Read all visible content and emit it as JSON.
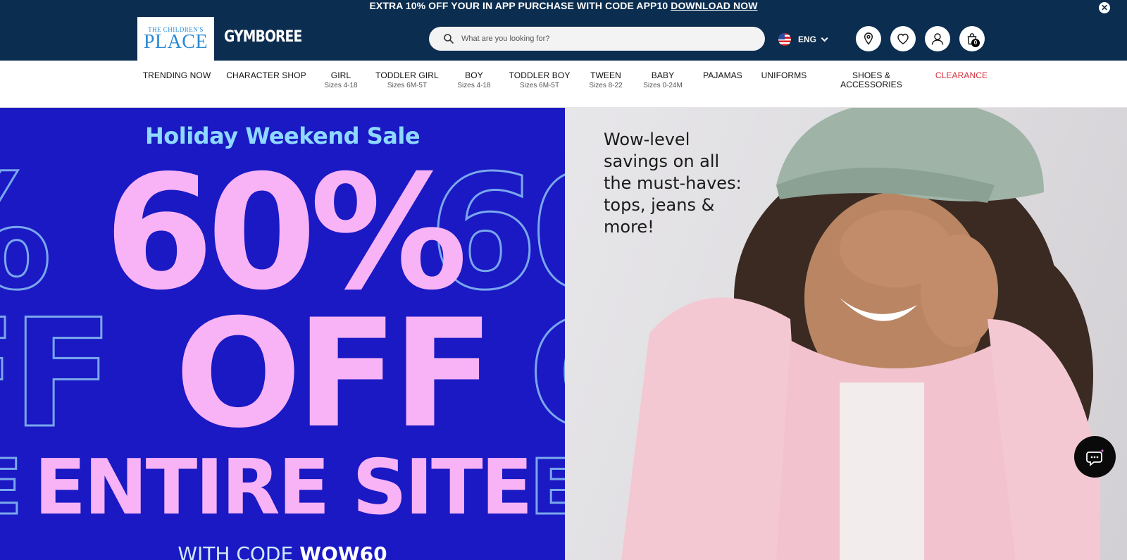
{
  "promo": {
    "text": "EXTRA 10% OFF YOUR IN APP PURCHASE WITH CODE APP10",
    "link": "DOWNLOAD NOW",
    "close_icon": "close-icon"
  },
  "header": {
    "logo_tcp_small": "THE CHILDREN'S",
    "logo_tcp_big": "PLACE",
    "logo_gymboree": "GYMBOREE",
    "search_placeholder": "What are you looking for?",
    "language": "ENG",
    "icons": [
      "location-icon",
      "heart-icon",
      "account-icon",
      "cart-icon"
    ],
    "cart_count": "0"
  },
  "nav": [
    {
      "label": "TRENDING NOW",
      "sub": ""
    },
    {
      "label": "CHARACTER SHOP",
      "sub": ""
    },
    {
      "label": "GIRL",
      "sub": "Sizes 4-18"
    },
    {
      "label": "TODDLER GIRL",
      "sub": "Sizes 6M-5T"
    },
    {
      "label": "BOY",
      "sub": "Sizes 4-18"
    },
    {
      "label": "TODDLER BOY",
      "sub": "Sizes 6M-5T"
    },
    {
      "label": "TWEEN",
      "sub": "Sizes 8-22"
    },
    {
      "label": "BABY",
      "sub": "Sizes 0-24M"
    },
    {
      "label": "PAJAMAS",
      "sub": ""
    },
    {
      "label": "UNIFORMS",
      "sub": ""
    },
    {
      "label": "SHOES &",
      "sub": "ACCESSORIES"
    },
    {
      "label": "CLEARANCE",
      "sub": ""
    }
  ],
  "hero": {
    "headline": "Holiday Weekend Sale",
    "percent": "60%",
    "off": "OFF",
    "entire_site": "ENTIRE SITE",
    "code_prefix": "WITH CODE",
    "code": "WOW60",
    "tagline": "Wow-level savings on all the must-haves: tops, jeans & more!"
  },
  "colors": {
    "header_bg": "#0b2d4f",
    "hero_blue": "#1a19c4",
    "hero_pink": "#f7b3f5",
    "headline_cyan": "#8fd8ff",
    "clearance_red": "#d32f3a"
  }
}
